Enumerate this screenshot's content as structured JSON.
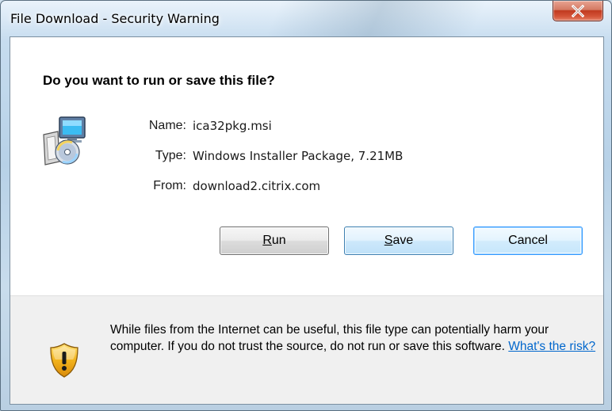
{
  "window": {
    "title": "File Download - Security Warning",
    "close_label": "X"
  },
  "dialog": {
    "question": "Do you want to run or save this file?",
    "file": {
      "name_label": "Name:",
      "name_value": "ica32pkg.msi",
      "type_label": "Type:",
      "type_value": "Windows Installer Package, 7.21MB",
      "from_label": "From:",
      "from_value": "download2.citrix.com"
    },
    "buttons": {
      "run_mnemonic": "R",
      "run_rest": "un",
      "save_mnemonic": "S",
      "save_rest": "ave",
      "cancel": "Cancel"
    },
    "warning": {
      "text": "While files from the Internet can be useful, this file type can potentially harm your computer. If you do not trust the source, do not run or save this software. ",
      "link": "What's the risk?"
    }
  },
  "colors": {
    "link": "#0066cc",
    "close_button": "#c0391f",
    "shield": "#f2b31c"
  },
  "icons": {
    "file": "installer-package-icon",
    "warning": "shield-warning-icon",
    "close": "close-icon"
  }
}
